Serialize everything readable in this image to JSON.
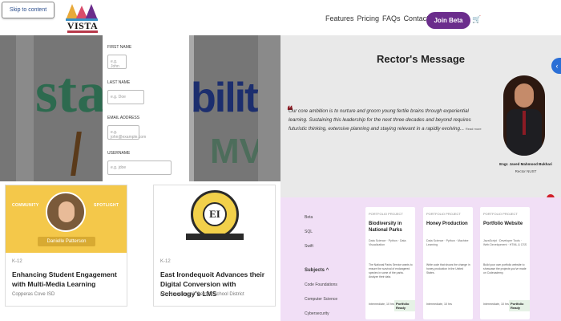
{
  "header": {
    "skip_label": "Skip to content",
    "logo_text": "VISTA",
    "nav": [
      "Features",
      "Pricing",
      "FAQs",
      "Contact"
    ],
    "beta_label": "Join Beta",
    "cart_icon": "cart-icon"
  },
  "sustainability": {
    "bg_letters_left": "sta",
    "bg_letters_right": "bility",
    "bg_letters_bottom": "MV",
    "form": {
      "fields": [
        {
          "label": "FIRST NAME",
          "placeholder": "e.g. John"
        },
        {
          "label": "LAST NAME",
          "placeholder": "e.g. Doe"
        },
        {
          "label": "EMAIL ADDRESS",
          "placeholder": "e.g. john@example.com"
        },
        {
          "label": "USERNAME",
          "placeholder": "e.g. jdoe"
        }
      ]
    }
  },
  "rector": {
    "title": "Rector's Message",
    "quote": "Our core ambition is to nurture and groom young fertile brains through experiential learning. Sustaining this leadership for the next three decades and beyond requires futuristic thinking, extensive planning and staying relevant in a rapidly evolving...",
    "read_more": "Read more",
    "name": "Engr. Javed Mahmood Bukhari",
    "role": "Rector NUST"
  },
  "cards": [
    {
      "banner_left": "COMMUNITY",
      "banner_right": "SPOTLIGHT",
      "person": "Danielle Patterson",
      "tag": "K-12",
      "title": "Enhancing Student Engagement with Multi-Media Learning",
      "sub": "Copperas Cove ISD"
    },
    {
      "seal_text": "EI",
      "tag": "K-12",
      "title": "East Irondequoit Advances their Digital Conversion with Schoology's LMS",
      "sub": "East Irondequoit Central School District"
    }
  ],
  "projects": {
    "filters_top": [
      "Beta",
      "SQL",
      "Swift"
    ],
    "subjects_heading": "Subjects",
    "subjects": [
      "Code Foundations",
      "Computer Science",
      "Cybersecurity"
    ],
    "cards": [
      {
        "tag": "PORTFOLIO PROJECT",
        "title": "Biodiversity in National Parks",
        "meta": "Data Science · Python · Data Visualization",
        "body": "The National Parks Service wants to ensure the survival of endangered species in some of the parks. Analyze their data.",
        "foot": "Intermediate, 10 hrs",
        "badge": "Portfolio Ready"
      },
      {
        "tag": "PORTFOLIO PROJECT",
        "title": "Honey Production",
        "meta": "Data Science · Python · Machine Learning",
        "body": "Write code that shows the change in honey production in the United States.",
        "foot": "Intermediate, 10 hrs",
        "badge": ""
      },
      {
        "tag": "PORTFOLIO PROJECT",
        "title": "Portfolio Website",
        "meta": "JavaScript · Developer Tools · Web Development · HTML & CSS",
        "body": "Build your own portfolio website to showcase the projects you've made on Codecademy.",
        "foot": "Intermediate, 10 hrs",
        "badge": "Portfolio Ready"
      }
    ]
  },
  "colors": {
    "brand": "#6b2d8c",
    "accent_blue": "#2b6fd6",
    "spotlight": "#f4c84a"
  }
}
